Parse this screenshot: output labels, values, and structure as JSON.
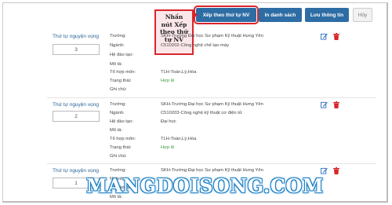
{
  "toolbar": {
    "sort_label": "Xếp theo thứ tự NV",
    "print_label": "In danh sách",
    "save_label": "Lưu thông tin",
    "cancel_label": "Hủy"
  },
  "callout": {
    "lines": [
      "Nhấn",
      "nút Xếp",
      "theo thứ",
      "tự NV"
    ]
  },
  "field_labels": {
    "order": "Thứ tự nguyện vọng",
    "school": "Trường:",
    "major": "Ngành:",
    "system": "Hệ đào tạo:",
    "description": "Mô tả:",
    "combo": "Tổ hợp môn:",
    "status": "Trạng thái:",
    "note": "Ghi chú:"
  },
  "records": [
    {
      "order": "3",
      "school": "SKH-Trường Đại học Sư phạm Kỹ thuật Hưng Yên",
      "major": "C510202-Công nghệ chế tạo máy",
      "system": "",
      "description": "",
      "combo": "TLH-Toán,Lý,Hóa",
      "status": "Hợp lệ",
      "note": ""
    },
    {
      "order": "2",
      "school": "SKH-Trường Đại học Sư phạm Kỹ thuật Hưng Yên",
      "major": "C510203-Công nghệ kỹ thuật cơ điện tử",
      "system": "Đại học",
      "description": "",
      "combo": "TLH-Toán,Lý,Hóa",
      "status": "Hợp lệ",
      "note": ""
    },
    {
      "order": "1",
      "school": "SKH-Trường Đại học Sư phạm Kỹ thuật Hưng Yên",
      "major": "",
      "system": "",
      "description": "",
      "combo": "",
      "status": "",
      "note": ""
    }
  ],
  "watermark": "MANGDOISONG.COM",
  "colors": {
    "primary_button": "#2e6da4",
    "highlight_red": "#d9252a",
    "status_green": "#3a9a3a",
    "label_blue": "#2a6496"
  }
}
